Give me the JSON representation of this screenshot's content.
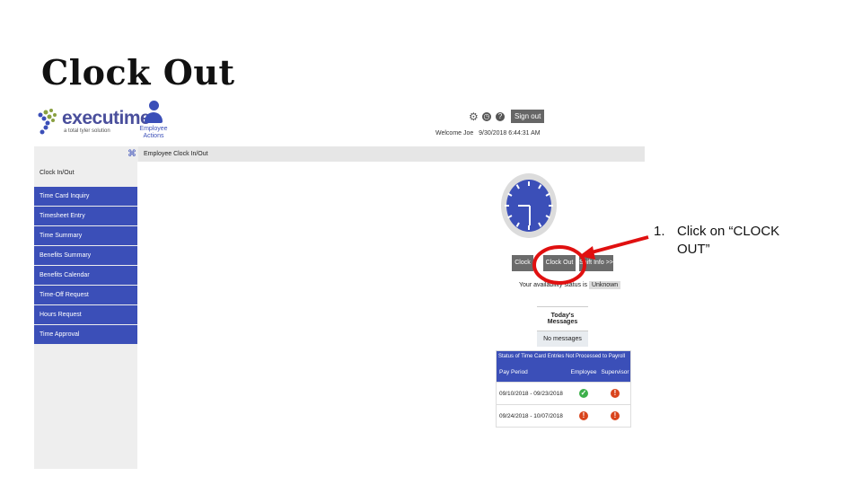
{
  "slide": {
    "title": "Clock Out",
    "annotation": {
      "number": "1.",
      "line1": "Click on “CLOCK",
      "line2": "OUT”"
    }
  },
  "app": {
    "logo_text": "executime",
    "logo_tagline": "a total tyler solution",
    "employee_actions_label": "Employee Actions",
    "top_icons": [
      "gear-icon",
      "timer-icon",
      "help-icon"
    ],
    "sign_out_label": "Sign out",
    "welcome_text": "Welcome Joe",
    "datetime": "9/30/2018  6:44:31 AM",
    "breadcrumb": "Employee Clock In/Out",
    "sidebar": {
      "items": [
        {
          "label": "Clock In/Out",
          "active": true
        },
        {
          "label": "Time Card Inquiry"
        },
        {
          "label": "Timesheet Entry"
        },
        {
          "label": "Time Summary"
        },
        {
          "label": "Benefits Summary"
        },
        {
          "label": "Benefits Calendar"
        },
        {
          "label": "Time-Off Request"
        },
        {
          "label": "Hours Request"
        },
        {
          "label": "Time Approval"
        }
      ]
    },
    "buttons": {
      "clock_in": "Clock In",
      "clock_out": "Clock Out",
      "shift_info": "Shift Info >>"
    },
    "availability": {
      "label": "Your availability status is",
      "value": "Unknown"
    },
    "messages": {
      "header": "Today's Messages",
      "body": "No messages"
    },
    "status_table": {
      "caption": "Status of Time Card Entries Not Processed to Payroll",
      "columns": [
        "Pay Period",
        "Employee",
        "Supervisor"
      ],
      "rows": [
        {
          "period": "09/10/2018 - 09/23/2018",
          "employee": "approved",
          "supervisor": "pending"
        },
        {
          "period": "09/24/2018 - 10/07/2018",
          "employee": "pending",
          "supervisor": "pending"
        }
      ]
    },
    "colors": {
      "brand_blue": "#3b4fb8",
      "button_gray": "#6b6b6b",
      "highlight_red": "#e01010",
      "ok_green": "#3cb04a",
      "alert_orange": "#d9441c"
    }
  }
}
